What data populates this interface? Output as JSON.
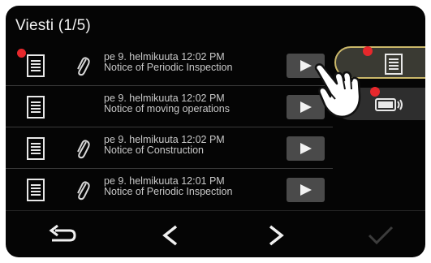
{
  "header": {
    "title": "Viesti (1/5)"
  },
  "messages": [
    {
      "date": "pe 9. helmikuuta 12:02 PM",
      "subject": "Notice of Periodic Inspection",
      "unread": true,
      "attachment": true
    },
    {
      "date": "pe 9. helmikuuta 12:02 PM",
      "subject": "Notice of moving operations",
      "unread": false,
      "attachment": false
    },
    {
      "date": "pe 9. helmikuuta 12:02 PM",
      "subject": "Notice of Construction",
      "unread": false,
      "attachment": true
    },
    {
      "date": "pe 9. helmikuuta 12:01 PM",
      "subject": "Notice of Periodic Inspection",
      "unread": false,
      "attachment": true
    }
  ],
  "side_buttons": [
    {
      "icon": "document-icon",
      "highlighted": true,
      "badge": true
    },
    {
      "icon": "battery-icon",
      "highlighted": false,
      "badge": true
    }
  ],
  "footer": {
    "buttons": [
      {
        "icon": "back-icon",
        "enabled": true
      },
      {
        "icon": "previous-icon",
        "enabled": true
      },
      {
        "icon": "next-icon",
        "enabled": true
      },
      {
        "icon": "confirm-check-icon",
        "enabled": false
      }
    ]
  },
  "colors": {
    "background": "#050505",
    "text": "#c9c9c9",
    "unread_badge": "#e6282c",
    "highlight_border": "#cbb86a"
  }
}
